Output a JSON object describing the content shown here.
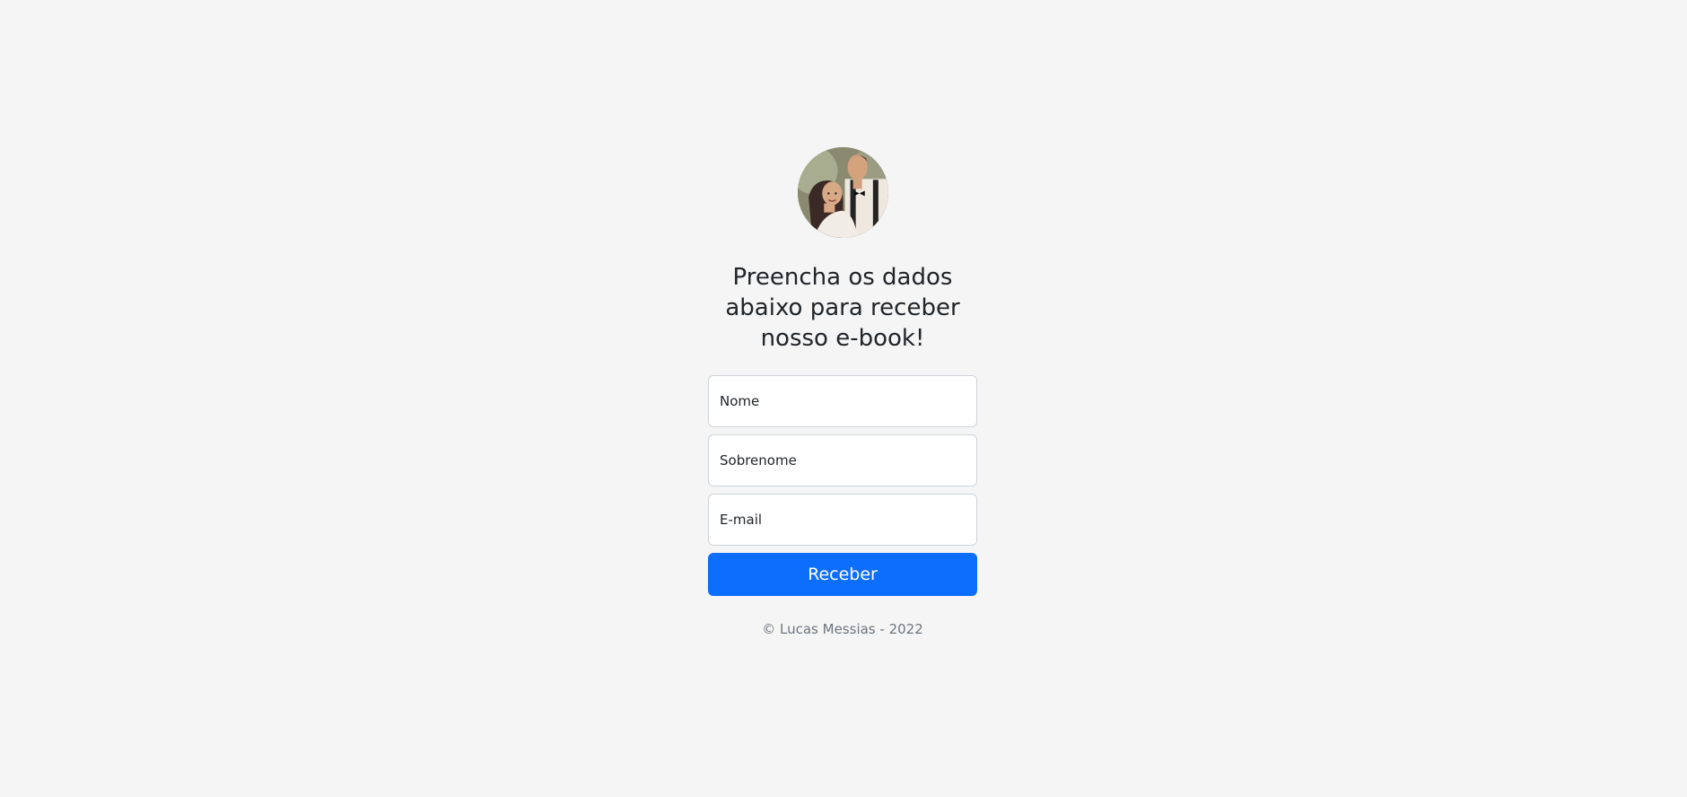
{
  "heading": {
    "title": "Preencha os dados abaixo para receber nosso e-book!"
  },
  "form": {
    "first_name_placeholder": "Nome",
    "last_name_placeholder": "Sobrenome",
    "email_placeholder": "E-mail",
    "submit_label": "Receber"
  },
  "footer": {
    "text": "© Lucas Messias - 2022"
  },
  "colors": {
    "background": "#f5f5f5",
    "button": "#0d6efd",
    "muted_text": "#6c757d"
  },
  "avatar": {
    "alt": "couple photo"
  }
}
